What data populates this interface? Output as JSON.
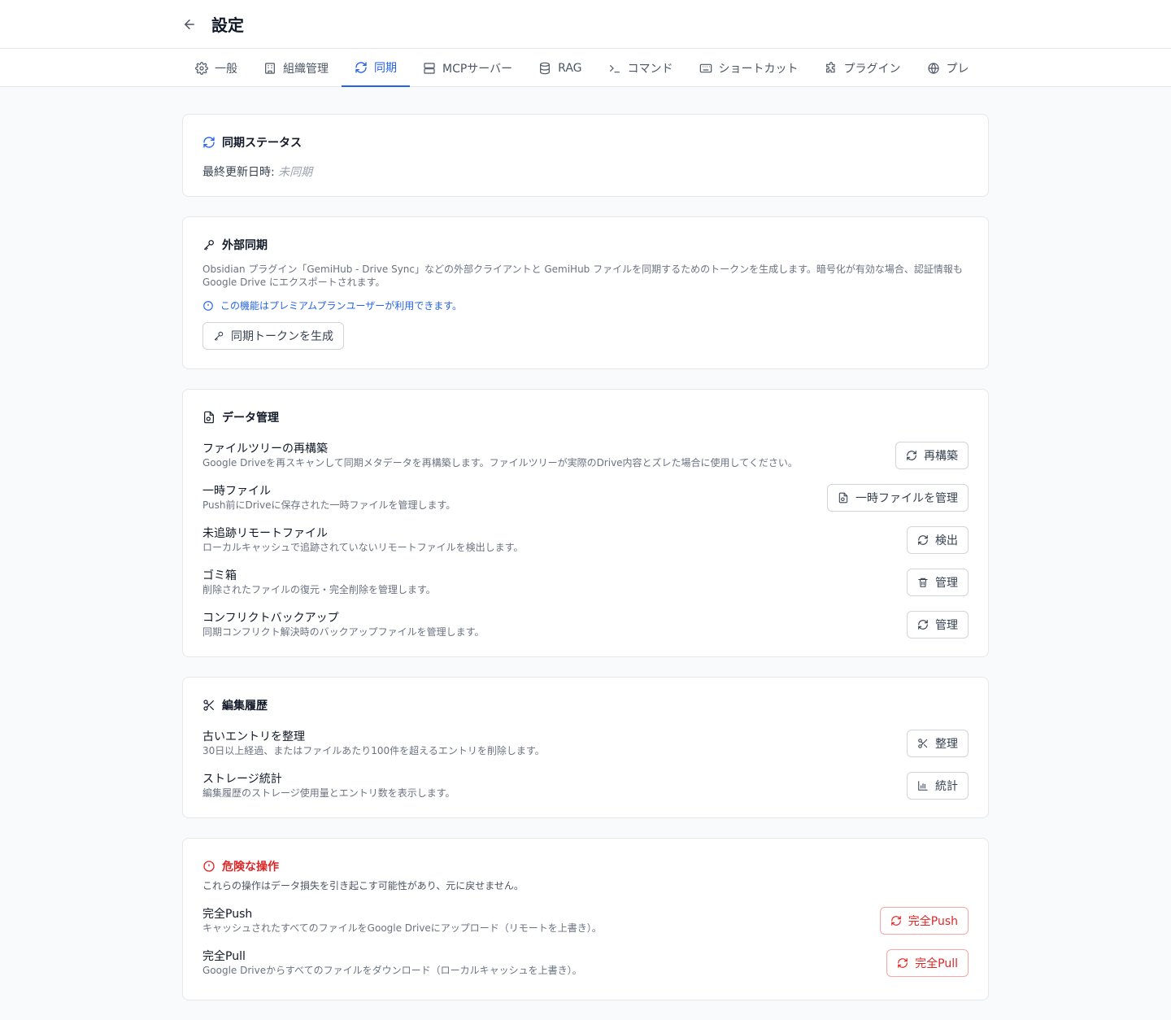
{
  "header": {
    "title": "設定"
  },
  "tabs": [
    {
      "label": "一般",
      "icon": "gear-icon"
    },
    {
      "label": "組織管理",
      "icon": "building-icon"
    },
    {
      "label": "同期",
      "icon": "sync-icon"
    },
    {
      "label": "MCPサーバー",
      "icon": "server-icon"
    },
    {
      "label": "RAG",
      "icon": "database-icon"
    },
    {
      "label": "コマンド",
      "icon": "terminal-icon"
    },
    {
      "label": "ショートカット",
      "icon": "keyboard-icon"
    },
    {
      "label": "プラグイン",
      "icon": "puzzle-icon"
    },
    {
      "label": "プレ",
      "icon": "globe-icon"
    }
  ],
  "status": {
    "title": "同期ステータス",
    "last_updated_label": "最終更新日時:",
    "last_updated_value": "未同期"
  },
  "external": {
    "title": "外部同期",
    "description": "Obsidian プラグイン「GemiHub - Drive Sync」などの外部クライアントと GemiHub ファイルを同期するためのトークンを生成します。暗号化が有効な場合、認証情報も Google Drive にエクスポートされます。",
    "premium_note": "この機能はプレミアムプランユーザーが利用できます。",
    "generate_button": "同期トークンを生成"
  },
  "data_mgmt": {
    "title": "データ管理",
    "items": [
      {
        "title": "ファイルツリーの再構築",
        "desc": "Google Driveを再スキャンして同期メタデータを再構築します。ファイルツリーが実際のDrive内容とズレた場合に使用してください。",
        "button": "再構築"
      },
      {
        "title": "一時ファイル",
        "desc": "Push前にDriveに保存された一時ファイルを管理します。",
        "button": "一時ファイルを管理"
      },
      {
        "title": "未追跡リモートファイル",
        "desc": "ローカルキャッシュで追跡されていないリモートファイルを検出します。",
        "button": "検出"
      },
      {
        "title": "ゴミ箱",
        "desc": "削除されたファイルの復元・完全削除を管理します。",
        "button": "管理"
      },
      {
        "title": "コンフリクトバックアップ",
        "desc": "同期コンフリクト解決時のバックアップファイルを管理します。",
        "button": "管理"
      }
    ]
  },
  "history": {
    "title": "編集履歴",
    "items": [
      {
        "title": "古いエントリを整理",
        "desc": "30日以上経過、またはファイルあたり100件を超えるエントリを削除します。",
        "button": "整理"
      },
      {
        "title": "ストレージ統計",
        "desc": "編集履歴のストレージ使用量とエントリ数を表示します。",
        "button": "統計"
      }
    ]
  },
  "danger": {
    "title": "危険な操作",
    "description": "これらの操作はデータ損失を引き起こす可能性があり、元に戻せません。",
    "items": [
      {
        "title": "完全Push",
        "desc": "キャッシュされたすべてのファイルをGoogle Driveにアップロード（リモートを上書き）。",
        "button": "完全Push"
      },
      {
        "title": "完全Pull",
        "desc": "Google Driveからすべてのファイルをダウンロード（ローカルキャッシュを上書き）。",
        "button": "完全Pull"
      }
    ]
  },
  "colors": {
    "accent": "#2563eb",
    "danger": "#dc2626"
  }
}
